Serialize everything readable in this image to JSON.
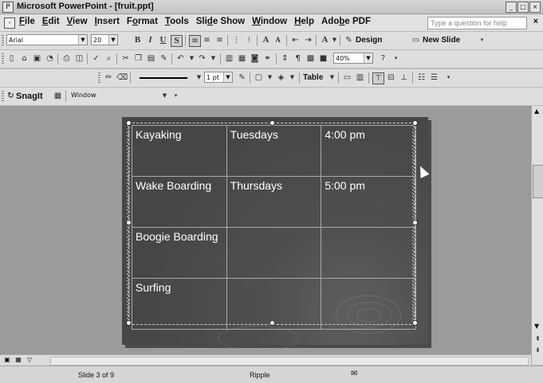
{
  "window": {
    "title": "Microsoft PowerPoint - [fruit.ppt]",
    "controls": [
      "_",
      "□",
      "×"
    ]
  },
  "menubar": {
    "items": [
      {
        "label": "File",
        "accel": "F"
      },
      {
        "label": "Edit",
        "accel": "E"
      },
      {
        "label": "View",
        "accel": "V"
      },
      {
        "label": "Insert",
        "accel": "I"
      },
      {
        "label": "Format",
        "accel": "o"
      },
      {
        "label": "Tools",
        "accel": "T"
      },
      {
        "label": "Slide Show",
        "accel": "d"
      },
      {
        "label": "Window",
        "accel": "W"
      },
      {
        "label": "Help",
        "accel": "H"
      },
      {
        "label": "Adobe PDF",
        "accel": "b"
      }
    ],
    "help_placeholder": "Type a question for help",
    "close_doc": "×"
  },
  "formatting_toolbar": {
    "font": "Arial",
    "size": "20",
    "buttons": [
      "B",
      "I",
      "U",
      "S"
    ],
    "design_label": "Design",
    "new_slide_label": "New Slide"
  },
  "standard_toolbar": {
    "zoom": "40%"
  },
  "tables_toolbar": {
    "line_weight": "1 pt",
    "table_label": "Table"
  },
  "snagit_toolbar": {
    "label": "SnagIt",
    "capture_mode": "Window"
  },
  "slide_table": {
    "rows": [
      [
        "Kayaking",
        "Tuesdays",
        "4:00 pm"
      ],
      [
        "Wake Boarding",
        "Thursdays",
        "5:00 pm"
      ],
      [
        "Boogie Boarding",
        "",
        ""
      ],
      [
        "Surfing",
        "",
        ""
      ]
    ]
  },
  "status": {
    "slide": "Slide 3 of 9",
    "design": "Ripple"
  },
  "colors": {
    "slide_background": "#4a4a4a",
    "table_text": "#ffffff",
    "table_border": "#a9a9a9"
  }
}
